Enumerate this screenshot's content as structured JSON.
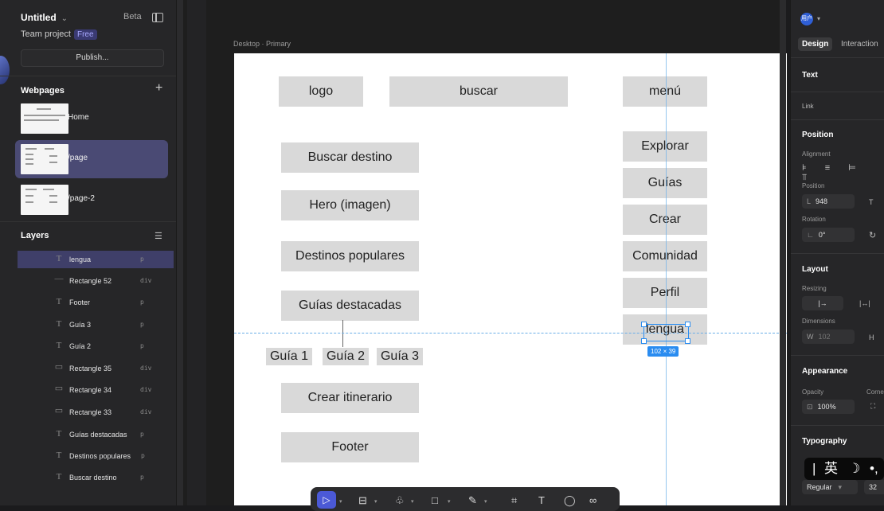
{
  "left_panel": {
    "title": "Untitled",
    "title_caret": "⌄",
    "beta_label": "Beta",
    "team_label": "Team project",
    "plan_badge": "Free",
    "publish_label": "Publish...",
    "webpages_header": "Webpages",
    "add_icon": "+",
    "pages": [
      {
        "label": "Home",
        "active": false
      },
      {
        "label": "/page",
        "active": true
      },
      {
        "label": "/page-2",
        "active": false
      }
    ],
    "layers_header": "Layers",
    "layers_icon": "☰",
    "layers": [
      {
        "icon": "T",
        "name": "lengua",
        "tag": "p",
        "selected": true
      },
      {
        "icon": "—",
        "name": "Rectangle 52",
        "tag": "div"
      },
      {
        "icon": "T",
        "name": "Footer",
        "tag": "p"
      },
      {
        "icon": "T",
        "name": "Guía 3",
        "tag": "p"
      },
      {
        "icon": "T",
        "name": "Guía 2",
        "tag": "p"
      },
      {
        "icon": "▭",
        "name": "Rectangle 35",
        "tag": "div"
      },
      {
        "icon": "▭",
        "name": "Rectangle 34",
        "tag": "div"
      },
      {
        "icon": "▭",
        "name": "Rectangle 33",
        "tag": "div"
      },
      {
        "icon": "T",
        "name": "Guías destacadas",
        "tag": "p"
      },
      {
        "icon": "T",
        "name": "Destinos populares",
        "tag": "p"
      },
      {
        "icon": "T",
        "name": "Buscar destino",
        "tag": "p"
      }
    ]
  },
  "canvas": {
    "frame_label": "Desktop · Primary",
    "wireframe": {
      "logo": "logo",
      "search": "buscar",
      "menu": "menú",
      "blocks": [
        "Buscar destino",
        "Hero (imagen)",
        "Destinos populares",
        "Guías destacadas"
      ],
      "guides": [
        "Guía 1",
        "Guía 2",
        "Guía 3"
      ],
      "itinerary": "Crear itinerario",
      "footer": "Footer",
      "nav": [
        "Explorar",
        "Guías",
        "Crear",
        "Comunidad",
        "Perfil",
        "lengua"
      ]
    },
    "selection_dimensions": "102 × 39",
    "toolbar": {
      "select_icon": "▷",
      "tools": [
        "⊟",
        "♧",
        "□",
        "✎",
        "⌗",
        "T",
        "◯",
        "∞"
      ]
    }
  },
  "right_panel": {
    "avatar_text": "用户",
    "tabs": [
      "Design",
      "Interaction"
    ],
    "text_header": "Text",
    "link_label": "Link",
    "position_header": "Position",
    "alignment_label": "Alignment",
    "alignment_icons": "⊧ ≡ ⊨ ⫪",
    "position_label": "Position",
    "position_l_label": "L",
    "position_l_value": "948",
    "position_t_label": "T",
    "rotation_label": "Rotation",
    "rotation_value": "0°",
    "layout_header": "Layout",
    "resizing_label": "Resizing",
    "resizing_icons": [
      "|→",
      "|↔|"
    ],
    "dimensions_label": "Dimensions",
    "width_label": "W",
    "width_value": "102",
    "height_label": "H",
    "appearance_header": "Appearance",
    "opacity_label": "Opacity",
    "opacity_value": "100%",
    "corner_label": "Corne",
    "typography_header": "Typography",
    "font_weight": "Regular",
    "font_size": "32",
    "ime_chars": [
      "|",
      "英",
      "☽",
      "•,"
    ]
  },
  "colors": {
    "accent": "#4b59d6",
    "selection": "#2a8cf0",
    "wire_box": "#d9d9d9",
    "panel": "#262628"
  }
}
